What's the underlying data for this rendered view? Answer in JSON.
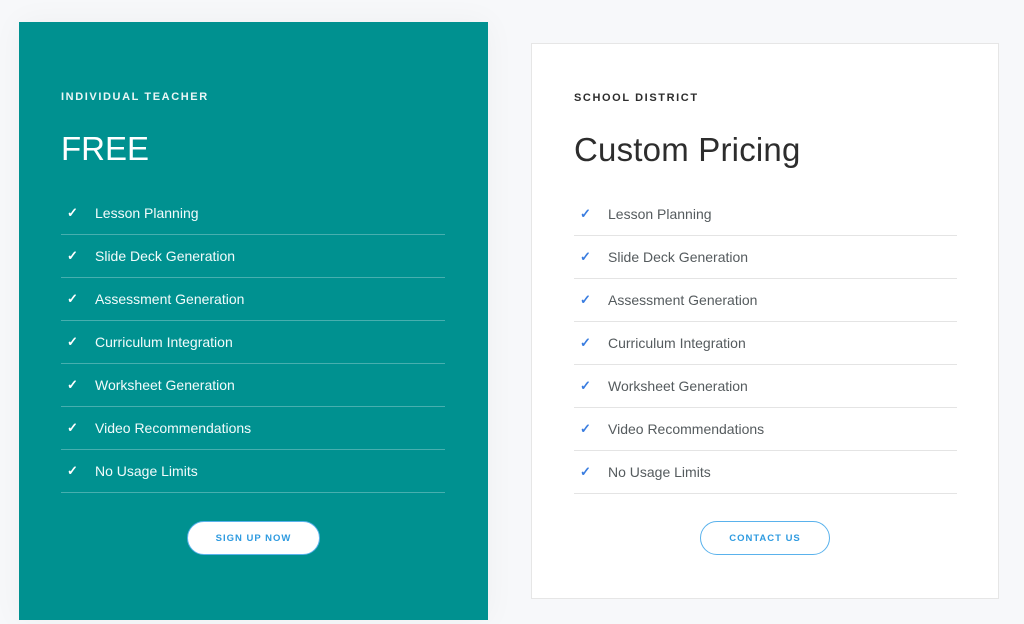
{
  "plans": [
    {
      "eyebrow": "INDIVIDUAL TEACHER",
      "price": "FREE",
      "features": [
        "Lesson Planning",
        "Slide Deck Generation",
        "Assessment Generation",
        "Curriculum Integration",
        "Worksheet Generation",
        "Video Recommendations",
        "No Usage Limits"
      ],
      "cta_label": "SIGN UP NOW",
      "background_color": "#009190"
    },
    {
      "eyebrow": "SCHOOL DISTRICT",
      "price": "Custom Pricing",
      "features": [
        "Lesson Planning",
        "Slide Deck Generation",
        "Assessment Generation",
        "Curriculum Integration",
        "Worksheet Generation",
        "Video Recommendations",
        "No Usage Limits"
      ],
      "cta_label": "CONTACT US",
      "background_color": "#ffffff"
    }
  ],
  "icons": {
    "feature_check": "check-icon"
  },
  "colors": {
    "accent_blue": "#2f9be0",
    "check_blue": "#3a7de0"
  }
}
